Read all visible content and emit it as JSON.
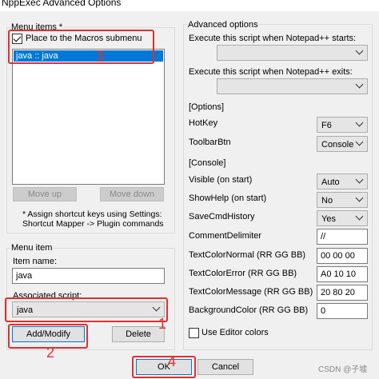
{
  "window": {
    "title": "NppExec Advanced Options"
  },
  "menu_items": {
    "group_label": "Menu items *",
    "place_to_macros_label": "Place to the Macros submenu",
    "place_to_macros_checked": true,
    "list_items": [
      "java :: java"
    ],
    "move_up_label": "Move up",
    "move_down_label": "Move down",
    "note": "* Assign shortcut keys using Settings: Shortcut Mapper -> Plugin commands"
  },
  "menu_item": {
    "group_label": "Menu item",
    "item_name_label": "Item name:",
    "item_name_value": "java",
    "associated_script_label": "Associated script:",
    "associated_script_value": "java",
    "add_modify_label": "Add/Modify",
    "delete_label": "Delete"
  },
  "advanced": {
    "group_label": "Advanced options",
    "on_start_label": "Execute this script when Notepad++ starts:",
    "on_start_value": "",
    "on_exit_label": "Execute this script when Notepad++ exits:",
    "on_exit_value": "",
    "options_label": "[Options]",
    "hotkey_label": "HotKey",
    "hotkey_value": "F6",
    "toolbarbtn_label": "ToolbarBtn",
    "toolbarbtn_value": "Console",
    "console_label": "[Console]",
    "visible_label": "Visible (on start)",
    "visible_value": "Auto",
    "showhelp_label": "ShowHelp (on start)",
    "showhelp_value": "No",
    "savecmd_label": "SaveCmdHistory",
    "savecmd_value": "Yes",
    "commentdelim_label": "CommentDelimiter",
    "commentdelim_value": "//",
    "tc_normal_label": "TextColorNormal (RR GG BB)",
    "tc_normal_value": "00 00 00",
    "tc_error_label": "TextColorError (RR GG BB)",
    "tc_error_value": "A0 10 10",
    "tc_message_label": "TextColorMessage (RR GG BB)",
    "tc_message_value": "20 80 20",
    "bgcolor_label": "BackgroundColor (RR GG BB)",
    "bgcolor_value": "0",
    "use_editor_colors_label": "Use Editor colors",
    "use_editor_colors_checked": false
  },
  "footer": {
    "ok_label": "OK",
    "cancel_label": "Cancel",
    "watermark": "CSDN @子墟"
  },
  "annotations": {
    "n1": "1",
    "n2": "2",
    "n3": "3",
    "n4": "4",
    "color": "#e03030"
  }
}
